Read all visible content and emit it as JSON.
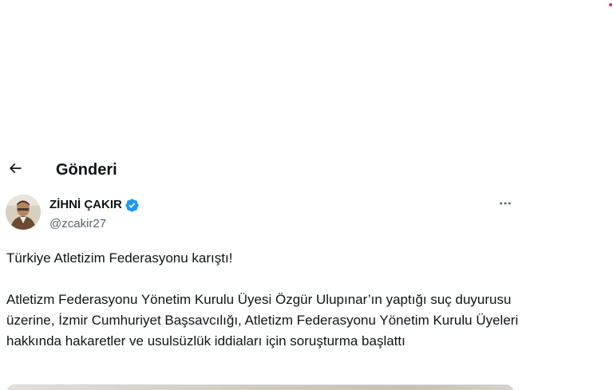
{
  "header": {
    "title": "Gönderi",
    "back_icon": "arrow-left-icon"
  },
  "author": {
    "name": "ZİHNİ ÇAKIR",
    "handle": "@zcakir27",
    "verified_icon": "verified-badge-icon",
    "verified_color": "#1d9bf0"
  },
  "more_icon": "more-horizontal-icon",
  "tweet": {
    "line1": "Türkiye Atletizim Federasyonu karıştı!",
    "paragraph2": "Atletizm Federasyonu Yönetim Kurulu Üyesi Özgür Ulupınar’ın yaptığı suç duyurusu üzerine, İzmir Cumhuriyet Başsavcılığı, Atletizm Federasyonu Yönetim Kurulu Üyeleri hakkında hakaretler ve usulsüzlük iddiaları için soruşturma başlattı"
  }
}
